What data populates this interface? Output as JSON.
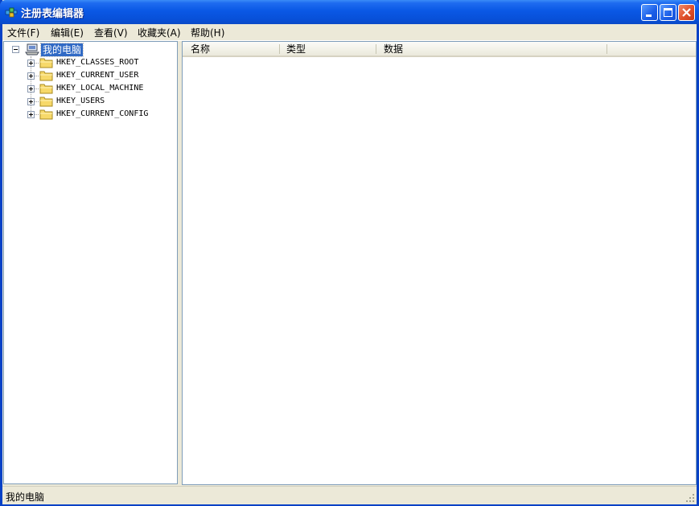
{
  "window": {
    "title": "注册表编辑器",
    "accent": "#0a58e5",
    "close_color": "#e0502a"
  },
  "menu": {
    "items": [
      {
        "label": "文件(F)"
      },
      {
        "label": "编辑(E)"
      },
      {
        "label": "查看(V)"
      },
      {
        "label": "收藏夹(A)"
      },
      {
        "label": "帮助(H)"
      }
    ]
  },
  "tree": {
    "root": {
      "label": "我的电脑",
      "icon": "computer-icon"
    },
    "keys": [
      {
        "label": "HKEY_CLASSES_ROOT",
        "icon": "folder-icon"
      },
      {
        "label": "HKEY_CURRENT_USER",
        "icon": "folder-icon"
      },
      {
        "label": "HKEY_LOCAL_MACHINE",
        "icon": "folder-icon"
      },
      {
        "label": "HKEY_USERS",
        "icon": "folder-icon"
      },
      {
        "label": "HKEY_CURRENT_CONFIG",
        "icon": "folder-icon"
      }
    ]
  },
  "list": {
    "columns": [
      {
        "label": "名称"
      },
      {
        "label": "类型"
      },
      {
        "label": "数据"
      }
    ]
  },
  "status": {
    "text": "我的电脑"
  }
}
